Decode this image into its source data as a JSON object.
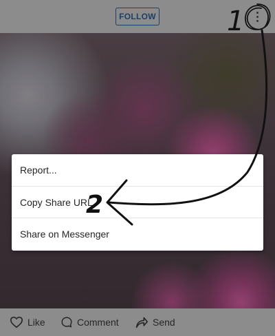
{
  "header": {
    "follow_label": "FOLLOW",
    "more_icon": "more-vertical-icon"
  },
  "menu": {
    "items": [
      {
        "label": "Report..."
      },
      {
        "label": "Copy Share URL"
      },
      {
        "label": "Share on Messenger"
      }
    ]
  },
  "annotations": {
    "step1": "1",
    "step2": "2"
  },
  "actions": {
    "like_label": "Like",
    "comment_label": "Comment",
    "send_label": "Send"
  },
  "colors": {
    "follow_accent": "#1e3f66",
    "overlay_bar": "#8c8c8c",
    "menu_bg": "#ffffff",
    "annotation_ink": "#111111"
  }
}
